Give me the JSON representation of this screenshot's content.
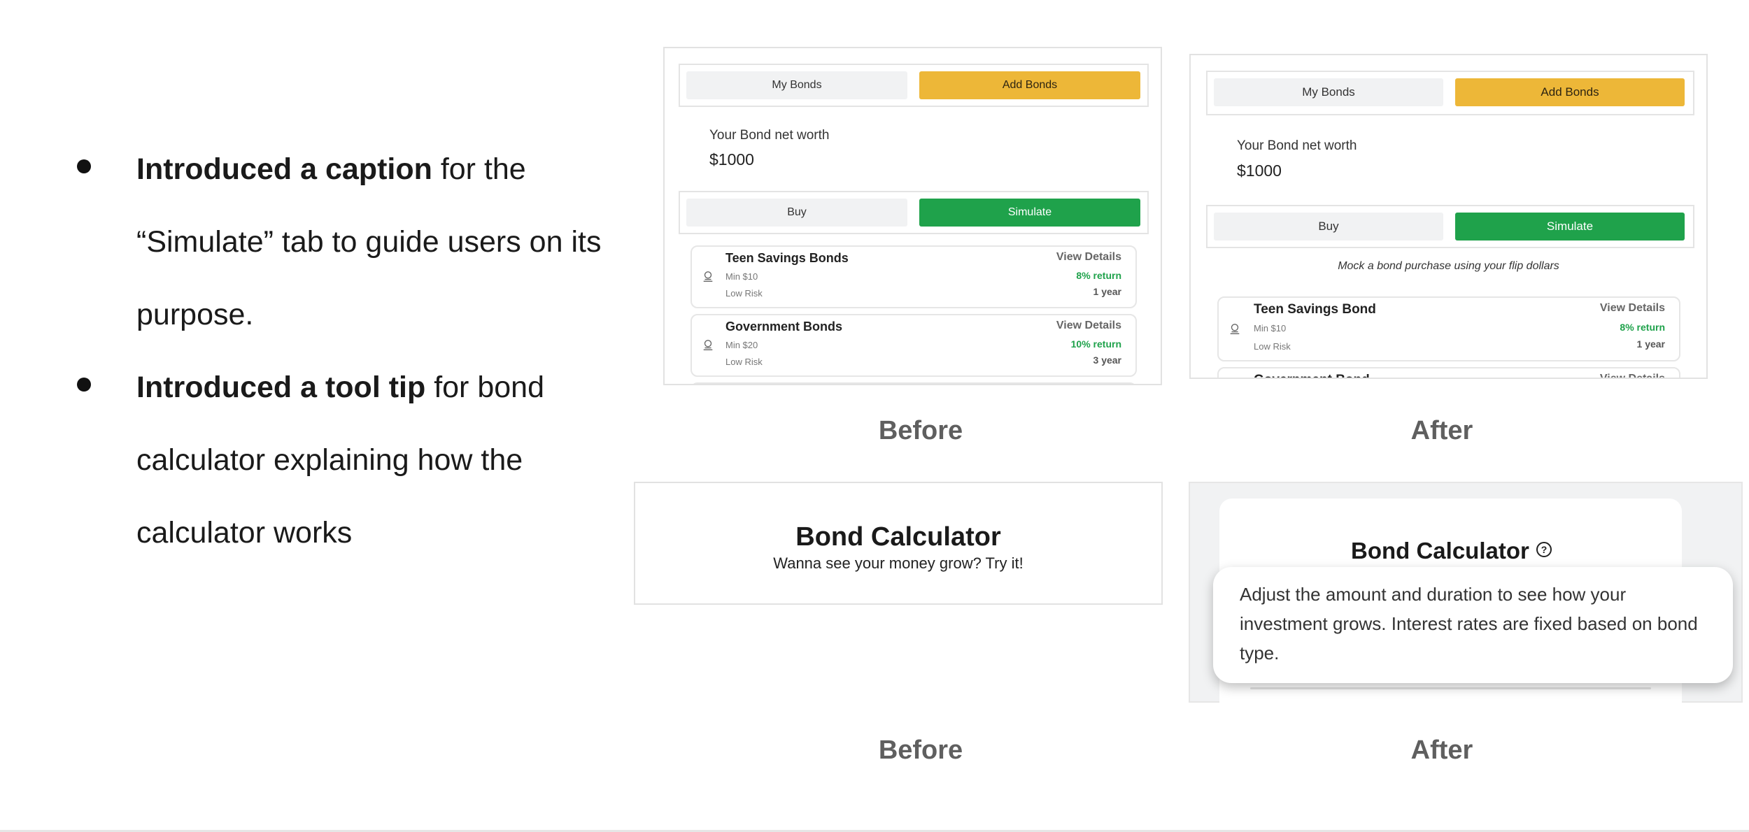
{
  "bullets": [
    {
      "bold": "Introduced a caption",
      "line1_rest": " for the",
      "line2": "“Simulate” tab to guide users on its",
      "line3": "purpose."
    },
    {
      "bold": "Introduced a tool tip",
      "line1_rest": " for bond",
      "line2": "calculator explaining how the",
      "line3": "calculator works"
    }
  ],
  "captions": {
    "before": "Before",
    "after": "After"
  },
  "before_app": {
    "tabs": [
      "My Bonds",
      "Add Bonds"
    ],
    "networth_label": "Your Bond net worth",
    "networth_value": "$1000",
    "actions": [
      "Buy",
      "Simulate"
    ],
    "bonds": [
      {
        "name": "Teen Savings Bonds",
        "min": "Min $10",
        "risk": "Low Risk",
        "details": "View Details",
        "return": "8% return",
        "term": "1 year"
      },
      {
        "name": "Government Bonds",
        "min": "Min $20",
        "risk": "Low Risk",
        "details": "View Details",
        "return": "10% return",
        "term": "3 year"
      }
    ]
  },
  "after_app": {
    "tabs": [
      "My Bonds",
      "Add Bonds"
    ],
    "networth_label": "Your Bond net worth",
    "networth_value": "$1000",
    "actions": [
      "Buy",
      "Simulate"
    ],
    "simulate_caption": "Mock a bond purchase using your flip dollars",
    "bonds": [
      {
        "name": "Teen Savings Bond",
        "min": "Min $10",
        "risk": "Low Risk",
        "details": "View Details",
        "return": "8% return",
        "term": "1 year"
      },
      {
        "name": "Government Bond",
        "details": "View Details"
      }
    ]
  },
  "calc_before": {
    "title": "Bond Calculator",
    "subtitle": "Wanna see your money grow? Try it!"
  },
  "calc_after": {
    "title": "Bond Calculator",
    "help_glyph": "?",
    "tooltip_lines": [
      "Adjust the amount and duration to see how your",
      "investment grows. Interest rates are fixed based on bond",
      "type."
    ]
  },
  "colors": {
    "yellow": "#edb738",
    "green": "#1fa24b",
    "caption_gray": "#5f5f5f"
  }
}
